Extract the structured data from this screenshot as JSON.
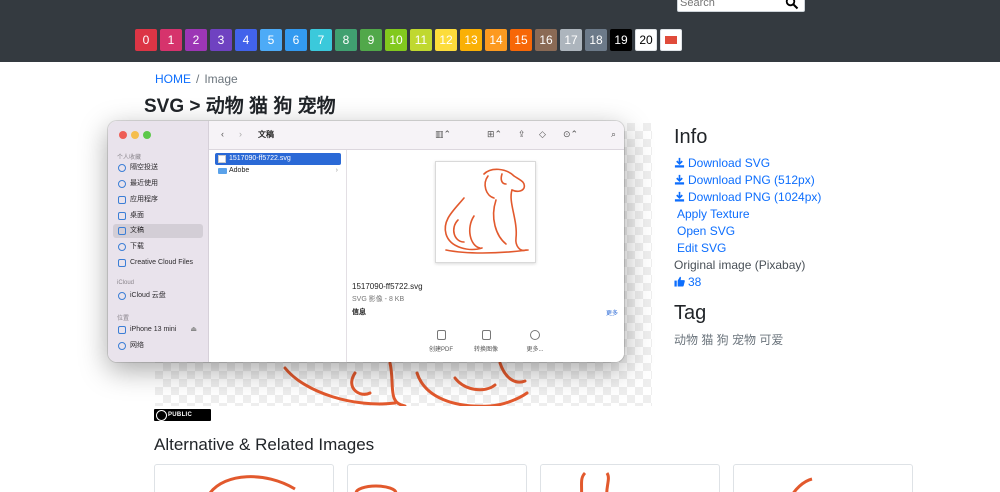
{
  "search": {
    "placeholder": "Search"
  },
  "swatches": [
    {
      "label": "0",
      "color": "#dc3545"
    },
    {
      "label": "1",
      "color": "#d6336c"
    },
    {
      "label": "2",
      "color": "#9c36b5"
    },
    {
      "label": "3",
      "color": "#6f42c1"
    },
    {
      "label": "4",
      "color": "#4263eb"
    },
    {
      "label": "5",
      "color": "#4dabf7"
    },
    {
      "label": "6",
      "color": "#339af0"
    },
    {
      "label": "7",
      "color": "#3bc9db"
    },
    {
      "label": "8",
      "color": "#40a070"
    },
    {
      "label": "9",
      "color": "#51a84a"
    },
    {
      "label": "10",
      "color": "#82c91e"
    },
    {
      "label": "11",
      "color": "#c0d82f"
    },
    {
      "label": "12",
      "color": "#fcdc3b"
    },
    {
      "label": "13",
      "color": "#fab005"
    },
    {
      "label": "14",
      "color": "#fd9a20"
    },
    {
      "label": "15",
      "color": "#f76707"
    },
    {
      "label": "16",
      "color": "#8a6a55"
    },
    {
      "label": "17",
      "color": "#adb5bd"
    },
    {
      "label": "18",
      "color": "#6c7a89"
    },
    {
      "label": "19",
      "color": "#000000"
    },
    {
      "label": "20",
      "color": "#ffffff"
    }
  ],
  "breadcrumb": {
    "home": "HOME",
    "separator": "/",
    "current": "Image"
  },
  "page_title": "SVG > 动物 猫 狗 宠物",
  "finder": {
    "title": "文稿",
    "sidebar": {
      "favorites_label": "个人收藏",
      "favorites": [
        "隔空投送",
        "最近使用",
        "应用程序",
        "桌面",
        "文稿",
        "下载",
        "Creative Cloud Files"
      ],
      "icloud_label": "iCloud",
      "icloud": [
        "iCloud 云盘"
      ],
      "locations_label": "位置",
      "locations": [
        "iPhone 13 mini",
        "网络"
      ]
    },
    "files": [
      "1517090-ff5722.svg",
      "Adobe"
    ],
    "preview": {
      "name": "1517090-ff5722.svg",
      "meta": "SVG 影像 - 8 KB",
      "info_label": "信息",
      "more_label": "更多",
      "actions": [
        "创建PDF",
        "转换图像",
        "更多..."
      ]
    }
  },
  "license_label": "PUBLIC DOMAIN",
  "alt_title": "Alternative & Related Images",
  "info": {
    "title": "Info",
    "links": {
      "download_svg": "Download SVG",
      "download_png_512": "Download PNG (512px)",
      "download_png_1024": "Download PNG (1024px)",
      "apply_texture": "Apply Texture",
      "open_svg": "Open SVG",
      "edit_svg": "Edit SVG"
    },
    "original": "Original image (Pixabay)",
    "likes": "38"
  },
  "tag": {
    "title": "Tag",
    "list": "动物 猫 狗 宠物 可爱"
  },
  "colors": {
    "accent": "#0d6efd",
    "line_art": "#e2592d",
    "topbar": "#343a40"
  }
}
